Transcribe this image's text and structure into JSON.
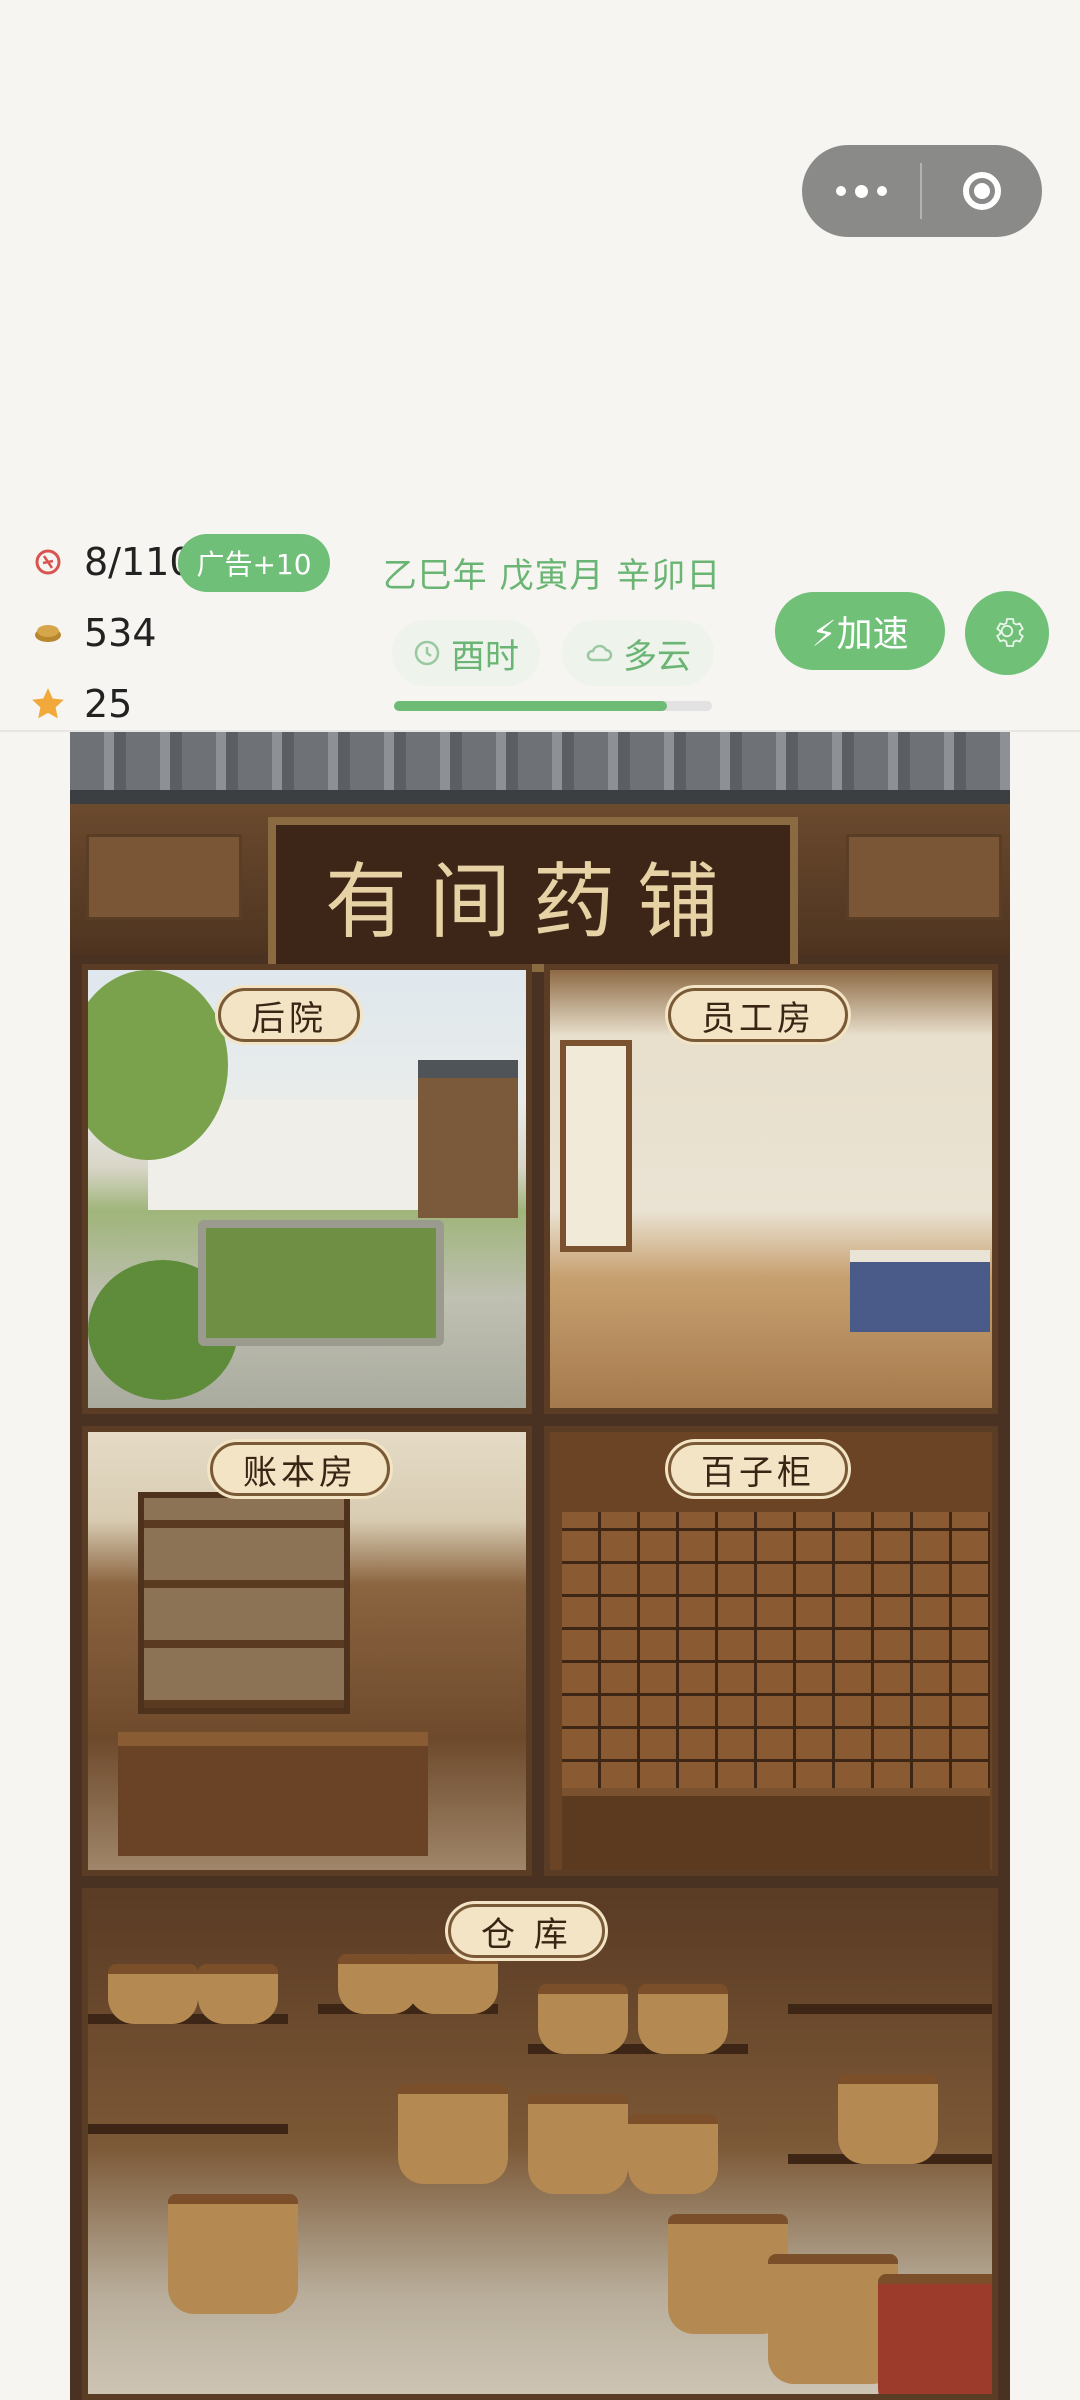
{
  "stats": {
    "energy": "8/110",
    "ad_button": "广告+10",
    "coins": "534",
    "stars": "25"
  },
  "calendar": {
    "date": "乙巳年 戊寅月 辛卯日",
    "time": "酉时",
    "weather": "多云",
    "day_progress": 0.86
  },
  "actions": {
    "speed_up": "⚡加速"
  },
  "scene": {
    "shop_name": "有间药铺",
    "rooms": {
      "backyard": "后院",
      "staff_room": "员工房",
      "account_room": "账本房",
      "herb_cabinet": "百子柜",
      "warehouse": "仓 库"
    }
  },
  "colors": {
    "accent_green": "#70c078",
    "text_green": "#6bb574",
    "background": "#f6f5f1"
  },
  "icons": {
    "energy": "energy-icon",
    "coins": "coin-icon",
    "stars": "star-icon",
    "time": "clock-icon",
    "weather": "cloud-icon",
    "settings": "gear-icon",
    "menu": "more-icon",
    "close": "record-icon"
  }
}
